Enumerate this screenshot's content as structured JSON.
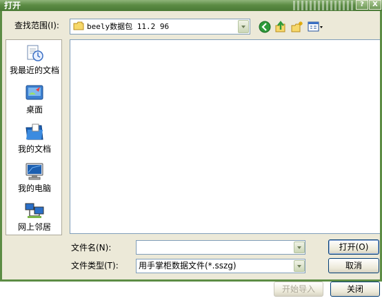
{
  "window": {
    "title": "打开",
    "help_label": "?",
    "close_label": "X"
  },
  "lookin": {
    "label": "查找范围(I):",
    "value": "beely数据包 11.2 96"
  },
  "places": [
    {
      "label": "我最近的文档",
      "icon": "recent-documents-icon"
    },
    {
      "label": "桌面",
      "icon": "desktop-icon"
    },
    {
      "label": "我的文档",
      "icon": "my-documents-icon"
    },
    {
      "label": "我的电脑",
      "icon": "my-computer-icon"
    },
    {
      "label": "网上邻居",
      "icon": "network-places-icon"
    }
  ],
  "filename": {
    "label": "文件名(N):",
    "value": ""
  },
  "filetype": {
    "label": "文件类型(T):",
    "value": "用手掌柜数据文件(*.sszg)"
  },
  "buttons": {
    "open": "打开(O)",
    "cancel": "取消",
    "start_import": "开始导入",
    "close": "关闭"
  },
  "colors": {
    "title_bar": "#5c8c44",
    "dialog_bg": "#ece9d8",
    "field_border": "#7f9db9"
  }
}
